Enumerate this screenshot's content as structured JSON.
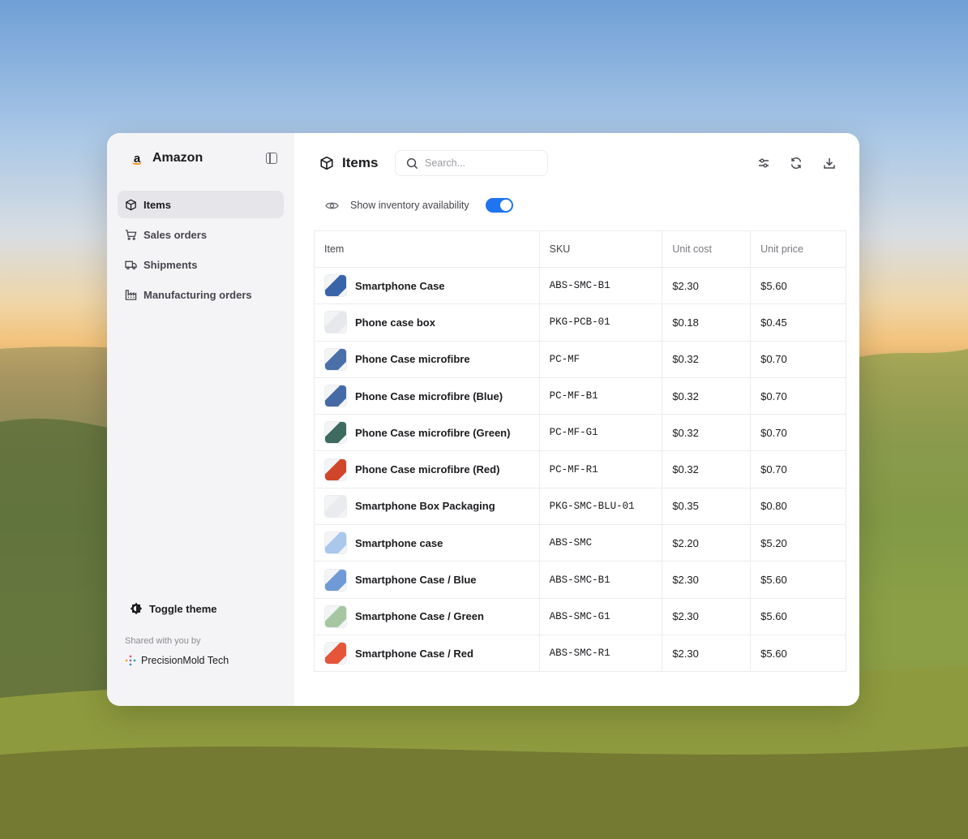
{
  "sidebar": {
    "brand": "Amazon",
    "items": [
      {
        "label": "Items",
        "icon": "box-icon",
        "active": true
      },
      {
        "label": "Sales orders",
        "icon": "cart-icon"
      },
      {
        "label": "Shipments",
        "icon": "truck-icon"
      },
      {
        "label": "Manufacturing orders",
        "icon": "factory-icon"
      }
    ],
    "toggle_theme": "Toggle theme",
    "shared_label": "Shared with you by",
    "shared_org": "PrecisionMold Tech"
  },
  "header": {
    "title": "Items",
    "search_placeholder": "Search..."
  },
  "availability": {
    "label": "Show inventory availability",
    "enabled": true,
    "accent": "#1f74f0"
  },
  "table": {
    "columns": [
      "Item",
      "SKU",
      "Unit cost",
      "Unit price"
    ],
    "rows": [
      {
        "name": "Smartphone Case",
        "sku": "ABS-SMC-B1",
        "cost": "$2.30",
        "price": "$5.60",
        "thumb": "#3a64a8"
      },
      {
        "name": "Phone case box",
        "sku": "PKG-PCB-01",
        "cost": "$0.18",
        "price": "$0.45",
        "thumb": "#e6e8ec"
      },
      {
        "name": "Phone Case microfibre",
        "sku": "PC-MF",
        "cost": "$0.32",
        "price": "$0.70",
        "thumb": "#4b6fa8"
      },
      {
        "name": "Phone Case microfibre (Blue)",
        "sku": "PC-MF-B1",
        "cost": "$0.32",
        "price": "$0.70",
        "thumb": "#456aa6"
      },
      {
        "name": "Phone Case microfibre (Green)",
        "sku": "PC-MF-G1",
        "cost": "$0.32",
        "price": "$0.70",
        "thumb": "#3f6a60"
      },
      {
        "name": "Phone Case microfibre (Red)",
        "sku": "PC-MF-R1",
        "cost": "$0.32",
        "price": "$0.70",
        "thumb": "#d0462a"
      },
      {
        "name": "Smartphone Box Packaging",
        "sku": "PKG-SMC-BLU-01",
        "cost": "$0.35",
        "price": "$0.80",
        "thumb": "#e9ebee"
      },
      {
        "name": "Smartphone case",
        "sku": "ABS-SMC",
        "cost": "$2.20",
        "price": "$5.20",
        "thumb": "#a9c8ec"
      },
      {
        "name": "Smartphone Case / Blue",
        "sku": "ABS-SMC-B1",
        "cost": "$2.30",
        "price": "$5.60",
        "thumb": "#6f9ad6"
      },
      {
        "name": "Smartphone Case / Green",
        "sku": "ABS-SMC-G1",
        "cost": "$2.30",
        "price": "$5.60",
        "thumb": "#a6c6a2"
      },
      {
        "name": "Smartphone Case / Red",
        "sku": "ABS-SMC-R1",
        "cost": "$2.30",
        "price": "$5.60",
        "thumb": "#e4553a"
      }
    ]
  }
}
